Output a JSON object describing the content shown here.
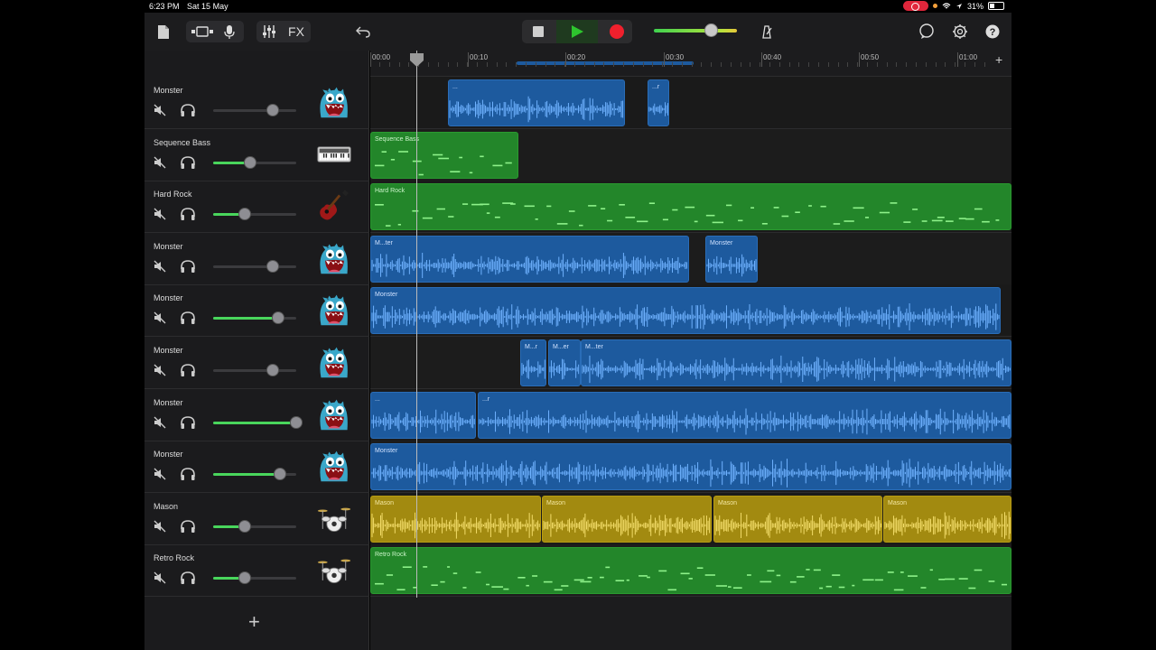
{
  "status": {
    "time": "6:23 PM",
    "date": "Sat 15 May",
    "battery": "31%"
  },
  "toolbar": {
    "fx_label": "FX",
    "icons": [
      "document-icon",
      "view-toggle-icon",
      "microphone-icon",
      "mixer-icon",
      "fx",
      "undo-icon",
      "stop-icon",
      "play-icon",
      "record-icon",
      "master-volume",
      "metronome-icon",
      "loop-icon",
      "settings-icon",
      "help-icon"
    ]
  },
  "ruler": {
    "labels": [
      "00:00",
      "00:10",
      "00:20",
      "00:30",
      "00:40",
      "00:50",
      "01:00"
    ]
  },
  "tracks": [
    {
      "name": "Monster",
      "fader": 0.72,
      "icon": "monster-icon"
    },
    {
      "name": "Sequence Bass",
      "fader": 0.45,
      "icon": "synth-keyboard-icon"
    },
    {
      "name": "Hard Rock",
      "fader": 0.38,
      "icon": "electric-guitar-icon"
    },
    {
      "name": "Monster",
      "fader": 0.72,
      "icon": "monster-icon"
    },
    {
      "name": "Monster",
      "fader": 0.78,
      "icon": "monster-icon"
    },
    {
      "name": "Monster",
      "fader": 0.72,
      "icon": "monster-icon"
    },
    {
      "name": "Monster",
      "fader": 1.0,
      "icon": "monster-icon"
    },
    {
      "name": "Monster",
      "fader": 0.8,
      "icon": "monster-icon"
    },
    {
      "name": "Mason",
      "fader": 0.38,
      "icon": "drum-kit-icon"
    },
    {
      "name": "Retro Rock",
      "fader": 0.38,
      "icon": "drum-kit-icon"
    }
  ],
  "regions": [
    {
      "lane": 0,
      "label": "...",
      "color": "blue"
    },
    {
      "lane": 0,
      "label": "...r",
      "color": "blue"
    },
    {
      "lane": 1,
      "label": "Sequence Bass",
      "color": "green"
    },
    {
      "lane": 2,
      "label": "Hard Rock",
      "color": "green"
    },
    {
      "lane": 3,
      "label": "M...ter",
      "color": "blue"
    },
    {
      "lane": 3,
      "label": "Monster",
      "color": "blue"
    },
    {
      "lane": 4,
      "label": "Monster",
      "color": "blue"
    },
    {
      "lane": 5,
      "label": "M...r",
      "color": "blue"
    },
    {
      "lane": 5,
      "label": "M...er",
      "color": "blue"
    },
    {
      "lane": 5,
      "label": "M...ter",
      "color": "blue"
    },
    {
      "lane": 6,
      "label": "...",
      "color": "blue"
    },
    {
      "lane": 6,
      "label": "...r",
      "color": "blue"
    },
    {
      "lane": 7,
      "label": "Monster",
      "color": "blue"
    },
    {
      "lane": 8,
      "label": "Mason",
      "color": "yellow"
    },
    {
      "lane": 8,
      "label": "Mason",
      "color": "yellow"
    },
    {
      "lane": 8,
      "label": "Mason",
      "color": "yellow"
    },
    {
      "lane": 8,
      "label": "Mason",
      "color": "yellow"
    },
    {
      "lane": 9,
      "label": "Retro Rock",
      "color": "green"
    }
  ],
  "colors": {
    "blue_region": "#1d5a9e",
    "green_region": "#23862a",
    "yellow_region": "#a28a10",
    "play": "#2ec52e",
    "record": "#f0202d"
  }
}
